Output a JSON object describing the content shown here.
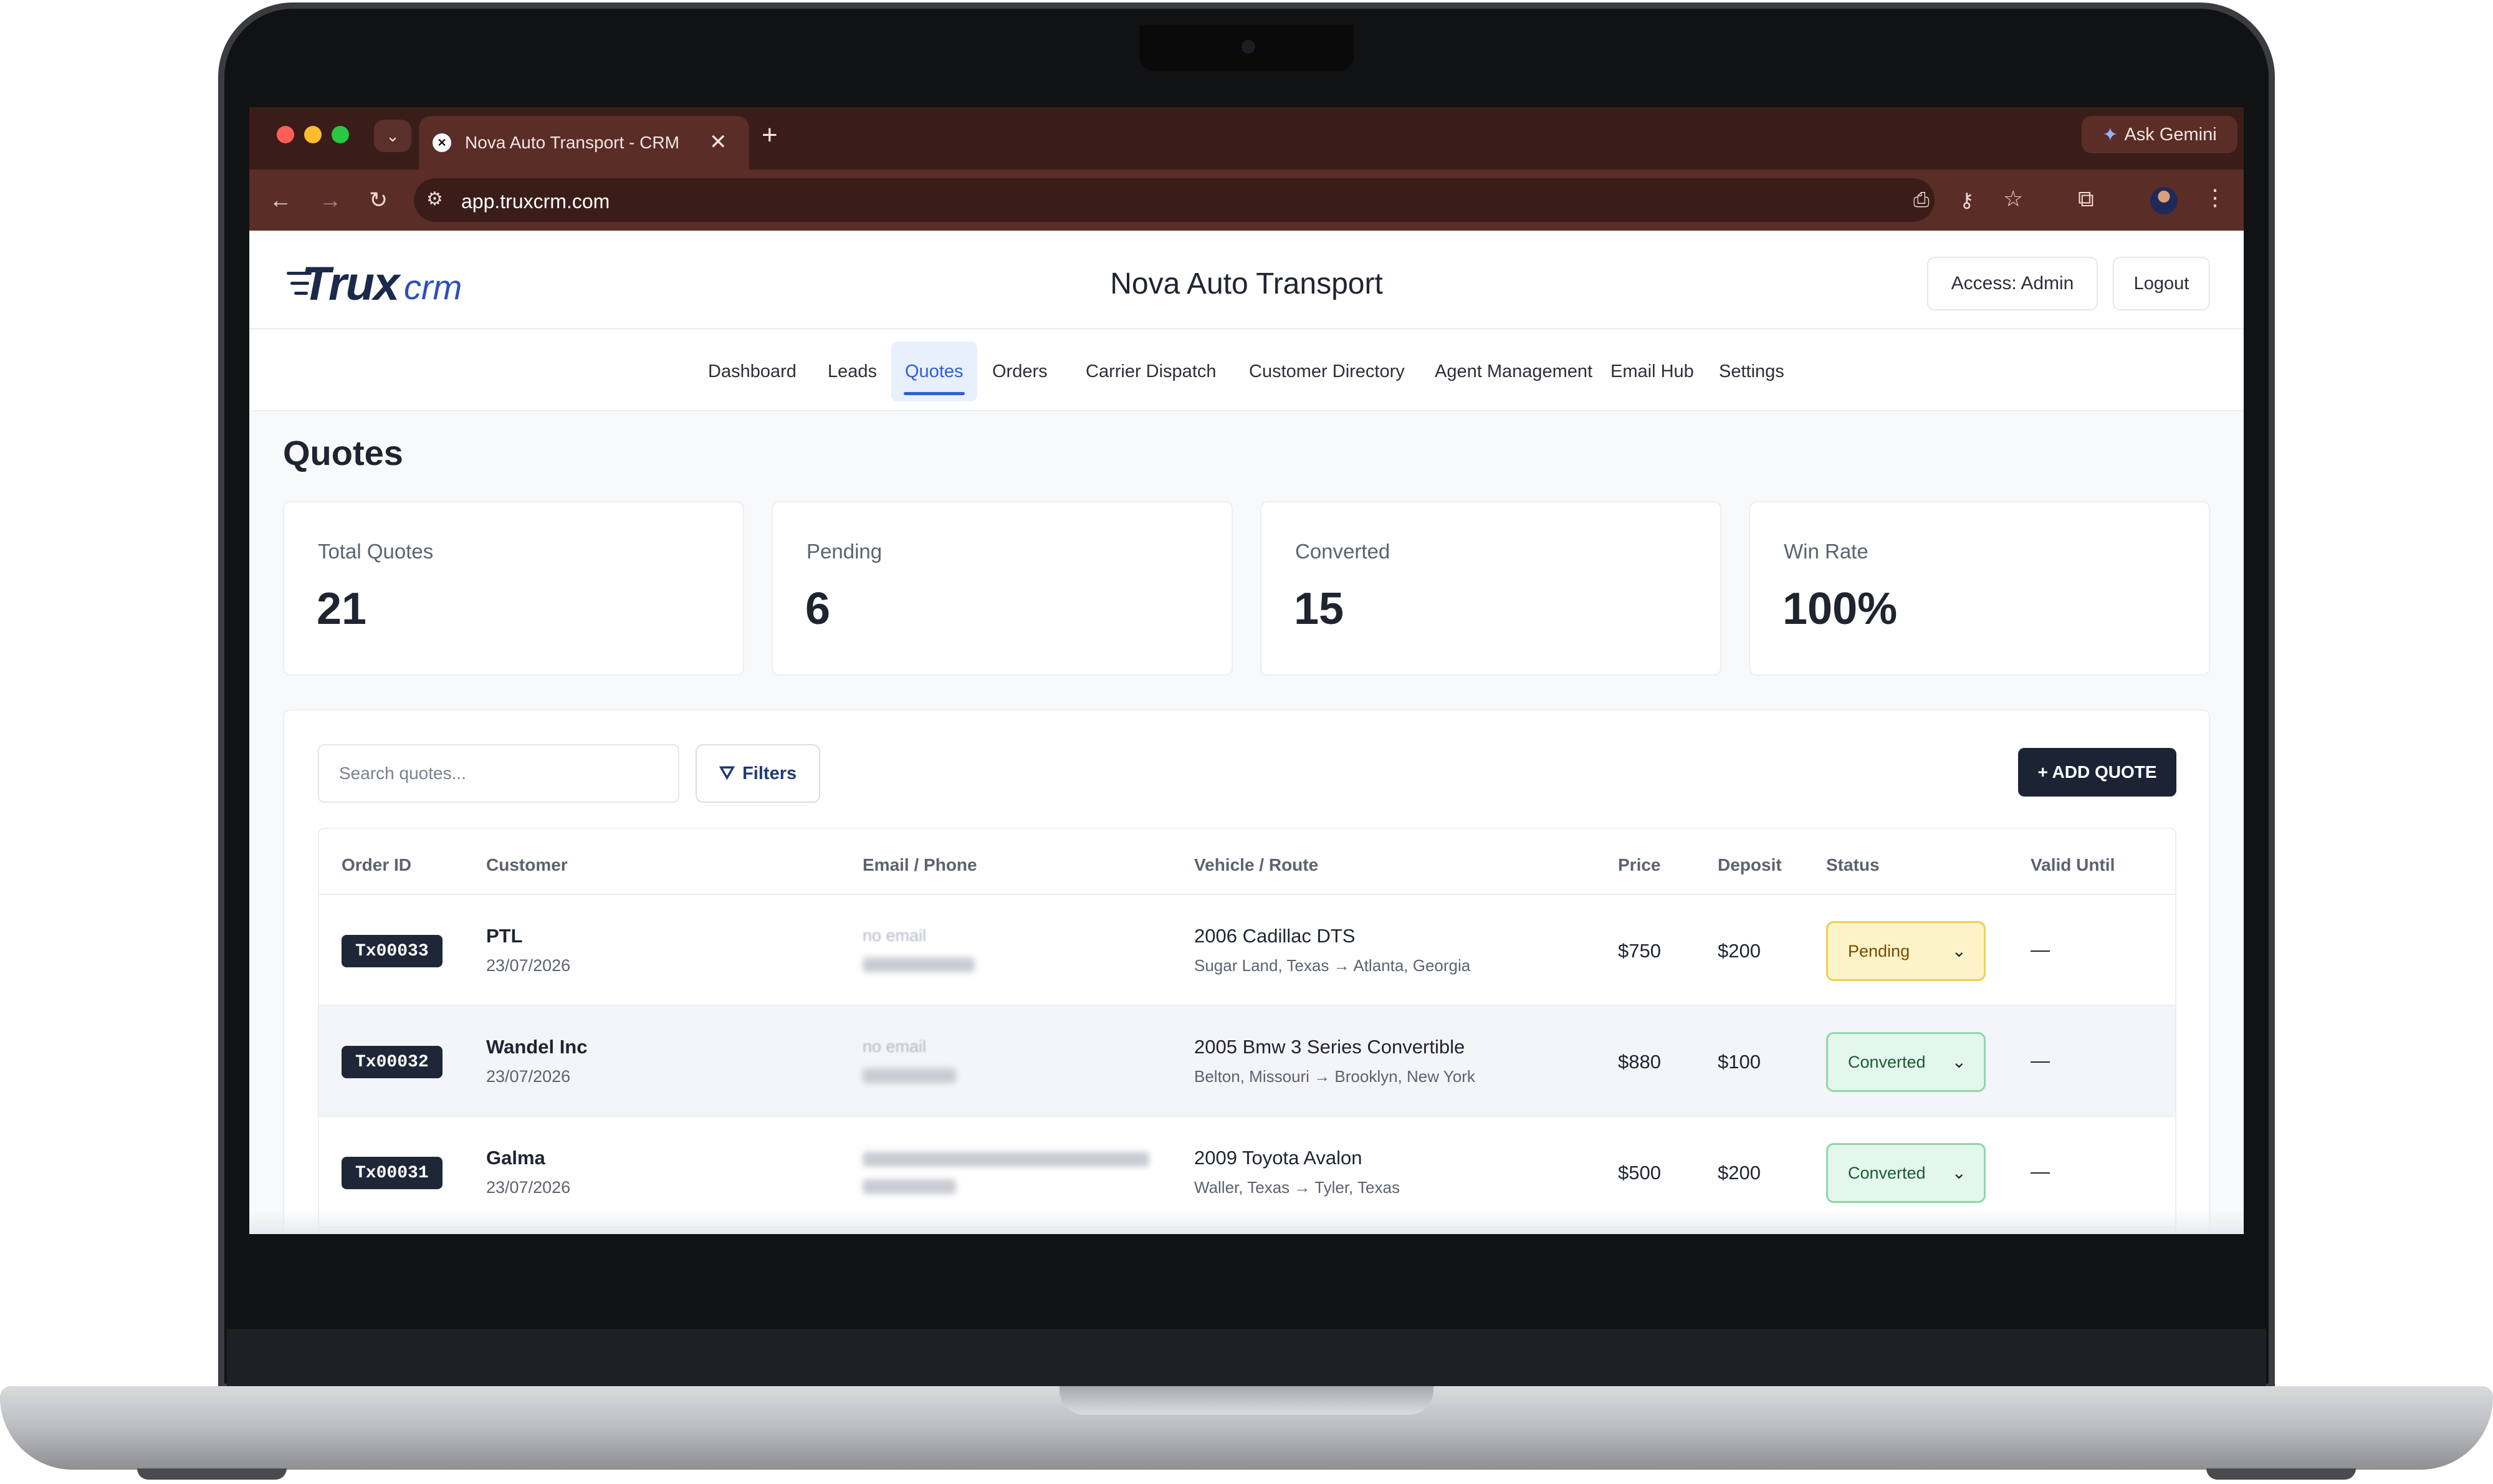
{
  "browser": {
    "tab_title": "Nova Auto Transport - CRM",
    "tab_close": "✕",
    "new_tab": "+",
    "ask_gemini": "Ask Gemini",
    "url": "app.truxcrm.com"
  },
  "app": {
    "logo_trux": "Trux",
    "logo_crm": "crm",
    "company_name": "Nova Auto Transport",
    "access_label": "Access: Admin",
    "logout_label": "Logout"
  },
  "nav": {
    "items": [
      {
        "label": "Dashboard"
      },
      {
        "label": "Leads"
      },
      {
        "label": "Quotes",
        "active": true
      },
      {
        "label": "Orders"
      },
      {
        "label": "Carrier Dispatch"
      },
      {
        "label": "Customer Directory"
      },
      {
        "label": "Agent Management"
      },
      {
        "label": "Email Hub"
      },
      {
        "label": "Settings"
      }
    ]
  },
  "page": {
    "title": "Quotes"
  },
  "stats": [
    {
      "label": "Total Quotes",
      "value": "21"
    },
    {
      "label": "Pending",
      "value": "6"
    },
    {
      "label": "Converted",
      "value": "15"
    },
    {
      "label": "Win Rate",
      "value": "100%"
    }
  ],
  "toolbar": {
    "search_placeholder": "Search quotes...",
    "filters_label": "Filters",
    "add_quote_label": "+ ADD QUOTE"
  },
  "table": {
    "columns": [
      "Order ID",
      "Customer",
      "Email / Phone",
      "Vehicle / Route",
      "Price",
      "Deposit",
      "Status",
      "Valid Until"
    ],
    "rows": [
      {
        "order_id": "Tx00033",
        "customer": "PTL",
        "date": "23/07/2026",
        "email": "no email",
        "vehicle": "2006 Cadillac DTS",
        "route": "Sugar Land, Texas → Atlanta, Georgia",
        "price": "$750",
        "deposit": "$200",
        "status": "Pending",
        "valid_until": "—"
      },
      {
        "order_id": "Tx00032",
        "customer": "Wandel Inc",
        "date": "23/07/2026",
        "email": "no email",
        "vehicle": "2005 Bmw 3 Series Convertible",
        "route": "Belton, Missouri → Brooklyn, New York",
        "price": "$880",
        "deposit": "$100",
        "status": "Converted",
        "valid_until": "—"
      },
      {
        "order_id": "Tx00031",
        "customer": "Galma",
        "date": "23/07/2026",
        "email": "",
        "vehicle": "2009 Toyota Avalon",
        "route": "Waller, Texas → Tyler, Texas",
        "price": "$500",
        "deposit": "$200",
        "status": "Converted",
        "valid_until": "—"
      }
    ]
  }
}
